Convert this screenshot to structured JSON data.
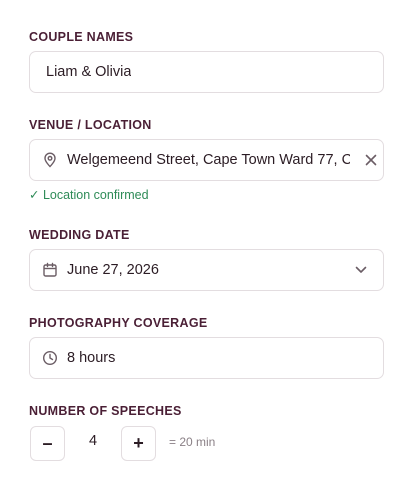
{
  "couple": {
    "label": "COUPLE NAMES",
    "value": "Liam & Olivia"
  },
  "venue": {
    "label": "VENUE / LOCATION",
    "value": "Welgemeend Street, Cape Town Ward 77, C",
    "confirmation": "✓ Location confirmed",
    "icon": "map-pin-icon",
    "clear_icon": "close-icon"
  },
  "date": {
    "label": "WEDDING DATE",
    "value": "June 27, 2026",
    "icon": "calendar-icon",
    "dropdown_icon": "chevron-down-icon"
  },
  "coverage": {
    "label": "PHOTOGRAPHY COVERAGE",
    "value": "8 hours",
    "icon": "clock-icon"
  },
  "speeches": {
    "label": "NUMBER OF SPEECHES",
    "decrement": "–",
    "increment": "+",
    "count": "4",
    "duration": "= 20 min"
  },
  "colors": {
    "label": "#4a1f35",
    "confirm": "#2e8b57",
    "border": "#e3dde0",
    "muted": "#8a8086"
  }
}
